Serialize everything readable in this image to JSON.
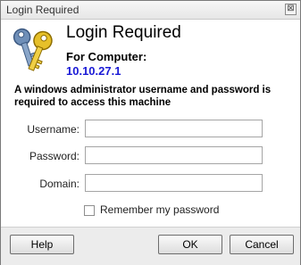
{
  "window": {
    "title": "Login Required",
    "close_glyph": "⊠"
  },
  "header": {
    "icon": "keys-icon",
    "heading": "Login Required",
    "for_label": "For Computer:",
    "computer": "10.10.27.1"
  },
  "description": "A windows administrator username and password is required to access this machine",
  "form": {
    "username_label": "Username:",
    "username_value": "",
    "password_label": "Password:",
    "password_value": "",
    "domain_label": "Domain:",
    "domain_value": "",
    "remember_label": "Remember my password",
    "remember_checked": false
  },
  "buttons": {
    "help": "Help",
    "ok": "OK",
    "cancel": "Cancel"
  }
}
